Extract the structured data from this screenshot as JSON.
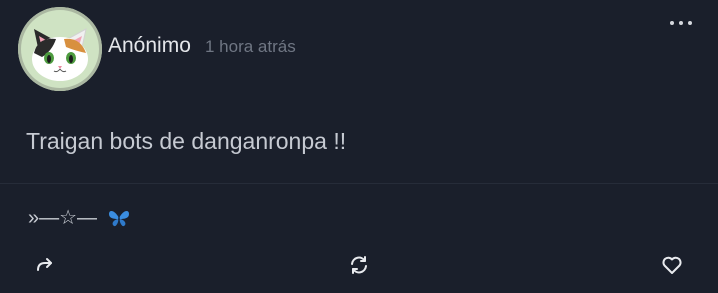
{
  "post": {
    "author": "Anónimo",
    "time": "1 hora atrás",
    "body": "Traigan bots de danganronpa !!",
    "signature": "»—☆—"
  },
  "icons": {
    "avatar": "calico-cat-avatar",
    "menu": "more-horizontal-icon",
    "butterfly": "butterfly-emoji",
    "share": "share-arrow-icon",
    "repost": "repost-icon",
    "like": "heart-icon"
  },
  "colors": {
    "background": "#1a1f2b",
    "text": "#d7dae0",
    "muted": "#6f7683",
    "butterfly": "#3a8de0"
  }
}
